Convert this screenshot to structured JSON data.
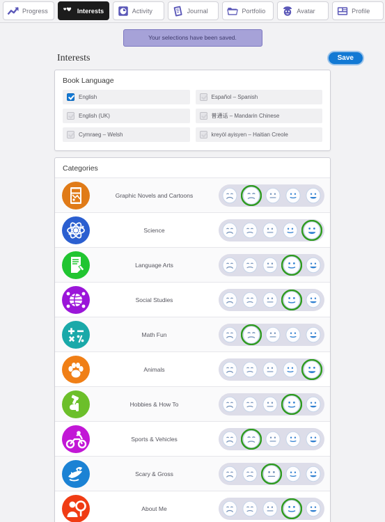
{
  "nav": {
    "tabs": [
      {
        "label": "Progress",
        "icon": "progress-chart-icon",
        "active": false
      },
      {
        "label": "Interests",
        "icon": "hearts-icon",
        "active": true
      },
      {
        "label": "Activity",
        "icon": "clock-book-icon",
        "active": false
      },
      {
        "label": "Journal",
        "icon": "journal-pencil-icon",
        "active": false
      },
      {
        "label": "Portfolio",
        "icon": "folder-icon",
        "active": false
      },
      {
        "label": "Avatar",
        "icon": "smiley-avatar-icon",
        "active": false
      },
      {
        "label": "Profile",
        "icon": "id-card-icon",
        "active": false
      }
    ]
  },
  "banner": {
    "message": "Your selections have been saved."
  },
  "page": {
    "title": "Interests",
    "save_label": "Save"
  },
  "book_language": {
    "title": "Book Language",
    "options": [
      {
        "label": "English",
        "checked": true
      },
      {
        "label": "Español – Spanish",
        "checked": false
      },
      {
        "label": "English (UK)",
        "checked": false
      },
      {
        "label": "普通话 – Mandarin Chinese",
        "checked": false
      },
      {
        "label": "Cymraeg – Welsh",
        "checked": false
      },
      {
        "label": "kreyòl ayisyen – Haitian Creole",
        "checked": false
      }
    ]
  },
  "categories": {
    "title": "Categories",
    "rating_scale": [
      "dislike",
      "slight-dislike",
      "neutral",
      "slight-like",
      "like"
    ],
    "rows": [
      {
        "label": "Graphic Novels and Cartoons",
        "icon": "comic-page-icon",
        "color": "#e07b18",
        "selected": 2
      },
      {
        "label": "Science",
        "icon": "atom-icon",
        "color": "#2b5fd0",
        "selected": 5
      },
      {
        "label": "Language Arts",
        "icon": "scroll-pen-icon",
        "color": "#21c531",
        "selected": 4
      },
      {
        "label": "Social Studies",
        "icon": "globe-people-icon",
        "color": "#9b16d9",
        "selected": 4
      },
      {
        "label": "Math Fun",
        "icon": "math-symbols-icon",
        "color": "#1aa9a9",
        "selected": 2
      },
      {
        "label": "Animals",
        "icon": "paw-print-icon",
        "color": "#f07f16",
        "selected": 5
      },
      {
        "label": "Hobbies & How To",
        "icon": "hammer-hand-icon",
        "color": "#6cbf2a",
        "selected": 4
      },
      {
        "label": "Sports & Vehicles",
        "icon": "motorcycle-icon",
        "color": "#c217d6",
        "selected": 2
      },
      {
        "label": "Scary & Gross",
        "icon": "creature-icon",
        "color": "#1b82d4",
        "selected": 3
      },
      {
        "label": "About Me",
        "icon": "person-mirror-icon",
        "color": "#f03c14",
        "selected": 4
      }
    ]
  },
  "colors": {
    "accent_blue": "#1279d4",
    "selected_green": "#2e9b1e",
    "banner_purple": "#a6a2d8",
    "face_track": "#dddde9",
    "page_background": "#f2f2f4"
  }
}
